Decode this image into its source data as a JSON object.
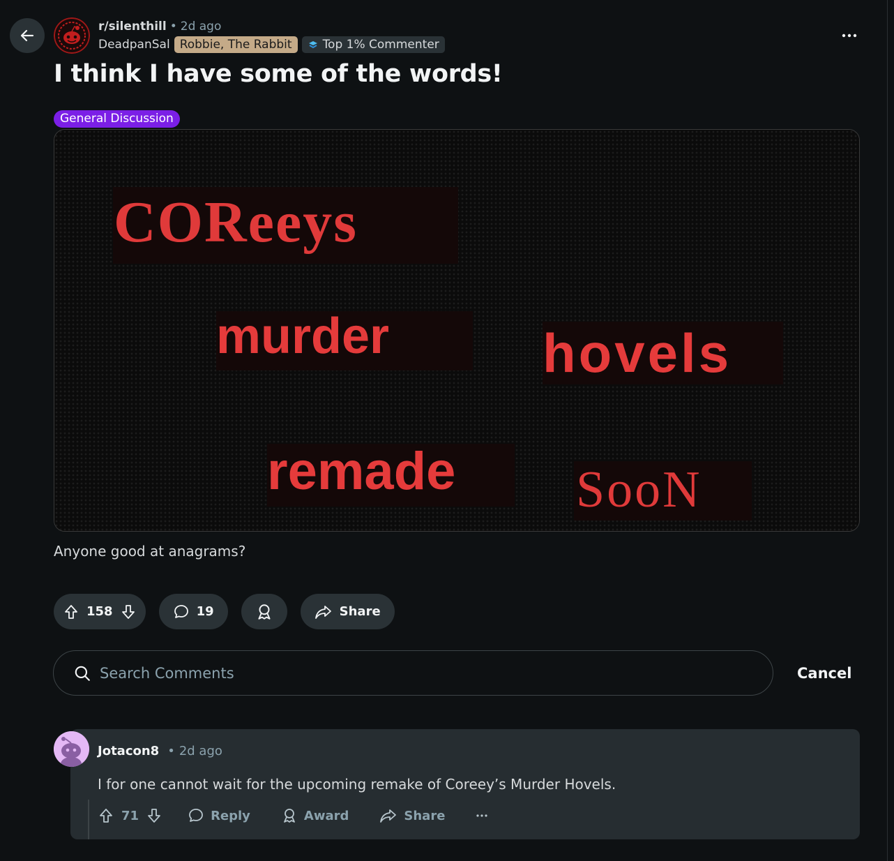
{
  "post": {
    "subreddit": "r/silenthill",
    "time": "2d ago",
    "author": "DeadpanSal",
    "user_flair": "Robbie, The Rabbit",
    "top_flair": "Top 1% Commenter",
    "title": "I think I have some of the words!",
    "post_flair": "General Discussion",
    "image_words": [
      "COReeys",
      "murder",
      "hovels",
      "remade",
      "SooN"
    ],
    "body": "Anyone good at anagrams?",
    "upvotes": "158",
    "comments": "19",
    "share_label": "Share"
  },
  "search": {
    "placeholder": "Search Comments",
    "cancel_label": "Cancel"
  },
  "comment": {
    "author": "Jotacon8",
    "time": "2d ago",
    "body": "I for one cannot wait for the upcoming remake of Coreey’s Murder Hovels.",
    "upvotes": "71",
    "reply_label": "Reply",
    "award_label": "Award",
    "share_label": "Share"
  },
  "colors": {
    "background": "#0e1113",
    "flair_purple": "#7b1fe6",
    "user_flair": "#c4aa88",
    "pill": "#2a3236"
  }
}
